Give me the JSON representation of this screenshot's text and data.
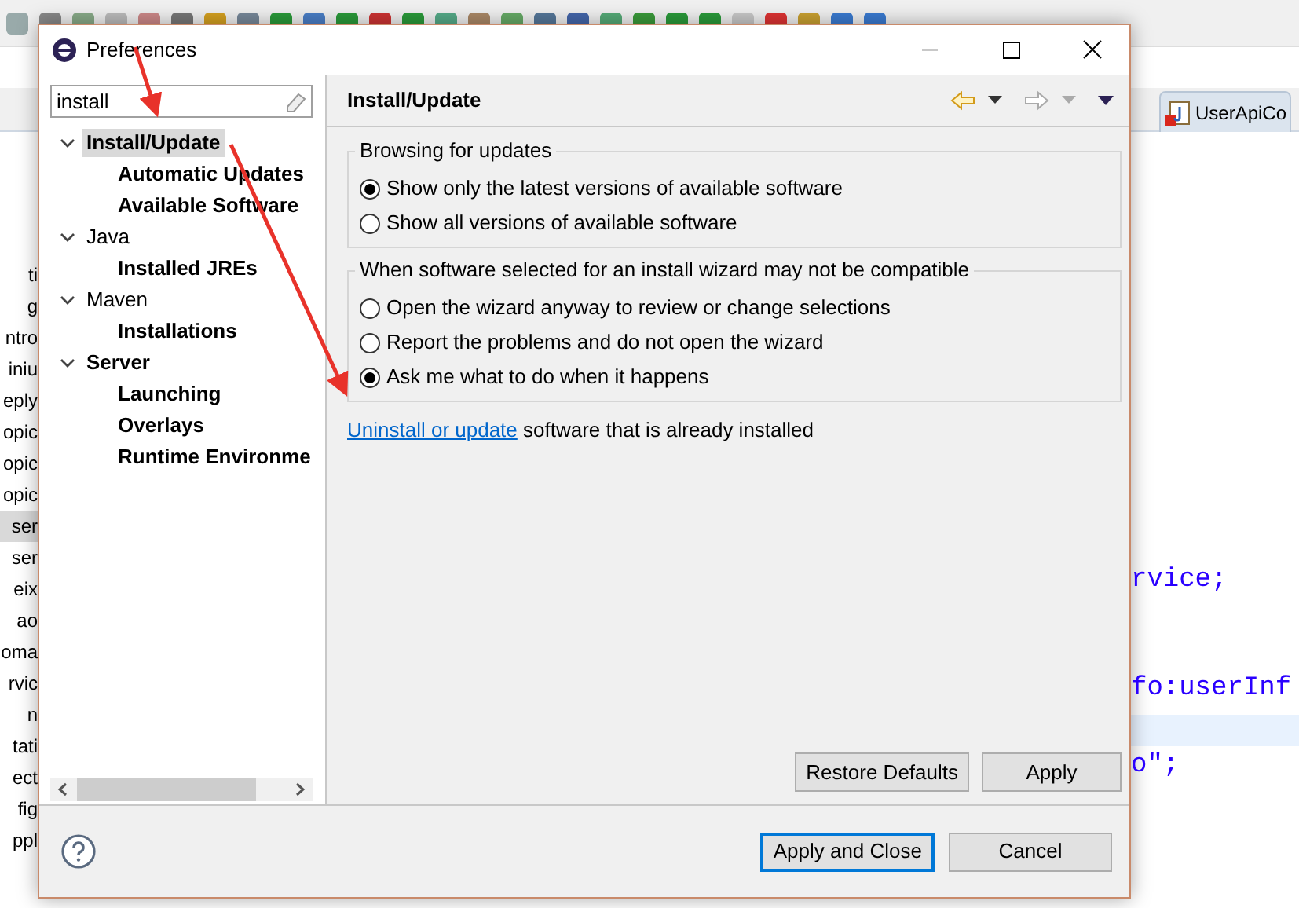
{
  "ide": {
    "explorer_items": [
      {
        "text": "ti",
        "selected": false
      },
      {
        "text": "g",
        "selected": false
      },
      {
        "text": "ntro",
        "selected": false
      },
      {
        "text": "iniu",
        "selected": false
      },
      {
        "text": "eply",
        "selected": false
      },
      {
        "text": "opic",
        "selected": false
      },
      {
        "text": "opic",
        "selected": false
      },
      {
        "text": "opic",
        "selected": false
      },
      {
        "text": "ser",
        "selected": true
      },
      {
        "text": "ser",
        "selected": false
      },
      {
        "text": "eix",
        "selected": false
      },
      {
        "text": "ao",
        "selected": false
      },
      {
        "text": "oma",
        "selected": false
      },
      {
        "text": "rvic",
        "selected": false
      },
      {
        "text": "n",
        "selected": false
      },
      {
        "text": "tati",
        "selected": false
      },
      {
        "text": "ect",
        "selected": false
      },
      {
        "text": "fig",
        "selected": false
      },
      {
        "text": "ppl",
        "selected": false
      }
    ],
    "editor_tab": "UserApiCo",
    "code_lines": [
      {
        "text": "rvice;"
      },
      {
        "text": "fo:userInf"
      },
      {
        "text": "o\";"
      }
    ]
  },
  "dialog": {
    "title": "Preferences",
    "filter": {
      "value": "install"
    },
    "tree": [
      {
        "label": "Install/Update",
        "bold": true,
        "expanded": true,
        "selected": true,
        "children": [
          {
            "label": "Automatic Updates",
            "bold": true,
            "selected": false
          },
          {
            "label": "Available Software",
            "bold": true,
            "selected": false
          }
        ]
      },
      {
        "label": "Java",
        "bold": false,
        "expanded": true,
        "selected": false,
        "children": [
          {
            "label": "Installed JREs",
            "bold": true,
            "selected": false
          }
        ]
      },
      {
        "label": "Maven",
        "bold": false,
        "expanded": true,
        "selected": false,
        "children": [
          {
            "label": "Installations",
            "bold": true,
            "selected": false
          }
        ]
      },
      {
        "label": "Server",
        "bold": true,
        "expanded": true,
        "selected": false,
        "children": [
          {
            "label": "Launching",
            "bold": true,
            "selected": false
          },
          {
            "label": "Overlays",
            "bold": true,
            "selected": false
          },
          {
            "label": "Runtime Environme",
            "bold": true,
            "selected": false
          }
        ]
      }
    ],
    "page_title": "Install/Update",
    "groups": [
      {
        "title": "Browsing for updates",
        "options": [
          {
            "label": "Show only the latest versions of available software",
            "selected": true
          },
          {
            "label": "Show all versions of available software",
            "selected": false
          }
        ]
      },
      {
        "title": "When software selected for an install wizard may not be compatible",
        "options": [
          {
            "label": "Open the wizard anyway to review or change selections",
            "selected": false
          },
          {
            "label": "Report the problems and do not open the wizard",
            "selected": false
          },
          {
            "label": "Ask me what to do when it happens",
            "selected": true
          }
        ]
      }
    ],
    "link_text": {
      "link": "Uninstall or update",
      "rest": " software that is already installed"
    },
    "page_buttons": [
      "Restore Defaults",
      "Apply"
    ],
    "dialog_buttons": [
      {
        "label": "Apply and Close",
        "default": true
      },
      {
        "label": "Cancel",
        "default": false
      }
    ]
  }
}
